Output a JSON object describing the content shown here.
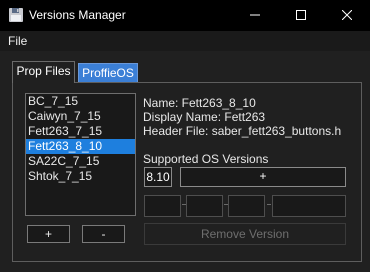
{
  "window": {
    "title": "Versions Manager",
    "icon": "floppy-disk-icon",
    "controls": {
      "minimize": "minimize-icon",
      "maximize": "maximize-icon",
      "close": "close-icon"
    }
  },
  "menu": {
    "file": "File"
  },
  "tabs": [
    {
      "label": "Prop Files",
      "active": true
    },
    {
      "label": "ProffieOS",
      "active": false
    }
  ],
  "prop_files": {
    "items": [
      {
        "label": "BC_7_15"
      },
      {
        "label": "Caiwyn_7_15"
      },
      {
        "label": "Fett263_7_15"
      },
      {
        "label": "Fett263_8_10",
        "selected": true
      },
      {
        "label": "SA22C_7_15"
      },
      {
        "label": "Shtok_7_15"
      }
    ],
    "add_label": "+",
    "remove_label": "-"
  },
  "details": {
    "name": "Name: Fett263_8_10",
    "display_name": "Display Name: Fett263",
    "header_file": "Header File: saber_fett263_buttons.h",
    "supported_heading": "Supported OS Versions",
    "os_versions": [
      "8.10"
    ],
    "add_os_label": "+",
    "remove_version_label": "Remove Version"
  },
  "colors": {
    "accent": "#1e7fde",
    "tab_accent": "#3b7fd6",
    "background": "#202020",
    "titlebar": "#000000"
  }
}
